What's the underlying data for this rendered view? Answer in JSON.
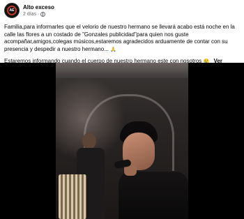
{
  "post": {
    "page_name": "Alto exceso",
    "time": "2 días",
    "body_text": "Familia,para informarles que el velorio de nuestro hermano se llevará acabo está noche  en la calle las flores a un costado de \"Gonzales publicidad\"para quien nos guste acompañar,amigos,colegas músicos,estaremos agradecidos arduamente de contar con su presencia y despedir a nuestro hermano...",
    "second_line": "Estaremos informando cuando el cuerpo de nuestro hermano este con nosotros",
    "see_more": "Ver menos",
    "avatar_logo_text": "AE"
  },
  "icons": {
    "privacy": "globe-icon",
    "emoji_pray": "praying-hands-emoji",
    "emoji_sad": "sad-emoji"
  },
  "colors": {
    "text": "#050505",
    "meta": "#65676b",
    "media_bg": "#000000"
  }
}
